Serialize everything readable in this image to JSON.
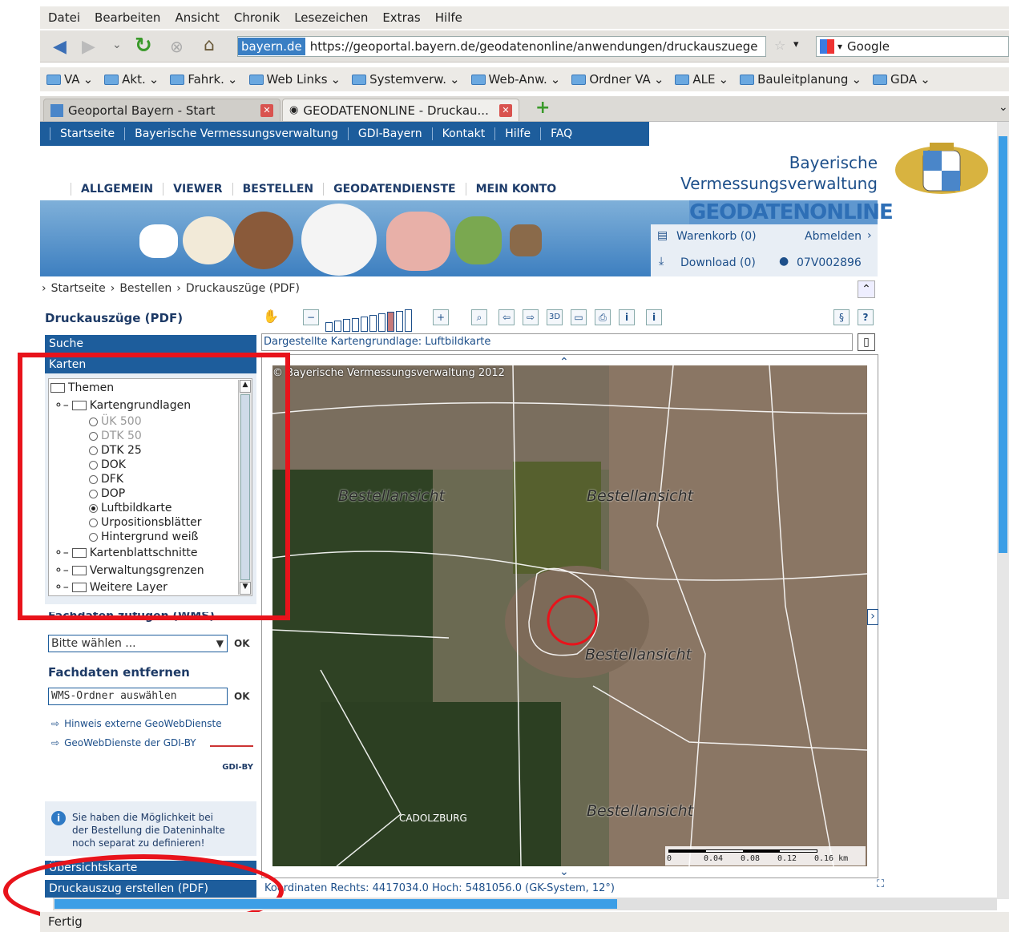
{
  "browser": {
    "menu": [
      "Datei",
      "Bearbeiten",
      "Ansicht",
      "Chronik",
      "Lesezeichen",
      "Extras",
      "Hilfe"
    ],
    "site_badge": "bayern.de",
    "url": "https://geoportal.bayern.de/geodatenonline/anwendungen/druckauszuege",
    "search_engine": "Google",
    "bookmarks": [
      "VA",
      "Akt.",
      "Fahrk.",
      "Web Links",
      "Systemverw.",
      "Web-Anw.",
      "Ordner VA",
      "ALE",
      "Bauleitplanung",
      "GDA"
    ],
    "tabs": [
      {
        "label": "Geoportal Bayern - Start"
      },
      {
        "label": "GEODATENONLINE - Druckau..."
      }
    ],
    "status": "Fertig"
  },
  "topnav": [
    "Startseite",
    "Bayerische Vermessungsverwaltung",
    "GDI-Bayern",
    "Kontakt",
    "Hilfe",
    "FAQ"
  ],
  "brand": {
    "line1": "Bayerische",
    "line2": "Vermessungsverwaltung",
    "banner": "GEODATENONLINE"
  },
  "mainnav": [
    "ALLGEMEIN",
    "VIEWER",
    "BESTELLEN",
    "GEODATENDIENSTE",
    "MEIN KONTO"
  ],
  "user": {
    "warenkorb": "Warenkorb (0)",
    "abmelden": "Abmelden",
    "download": "Download (0)",
    "userid": "07V002896"
  },
  "breadcrumb": [
    "Startseite",
    "Bestellen",
    "Druckauszüge (PDF)"
  ],
  "left": {
    "title": "Druckauszüge (PDF)",
    "suche": "Suche",
    "karten": "Karten",
    "tree": {
      "themen": "Themen",
      "kartengrundlagen": "Kartengrundlagen",
      "options": [
        {
          "label": "ÜK 500",
          "enabled": false,
          "selected": false
        },
        {
          "label": "DTK 50",
          "enabled": false,
          "selected": false
        },
        {
          "label": "DTK 25",
          "enabled": true,
          "selected": false
        },
        {
          "label": "DOK",
          "enabled": true,
          "selected": false
        },
        {
          "label": "DFK",
          "enabled": true,
          "selected": false
        },
        {
          "label": "DOP",
          "enabled": true,
          "selected": false
        },
        {
          "label": "Luftbildkarte",
          "enabled": true,
          "selected": true
        },
        {
          "label": "Urpositionsblätter",
          "enabled": true,
          "selected": false
        },
        {
          "label": "Hintergrund weiß",
          "enabled": true,
          "selected": false
        }
      ],
      "kartenblattschnitte": "Kartenblattschnitte",
      "verwaltungsgrenzen": "Verwaltungsgrenzen",
      "weitere": "Weitere Layer"
    },
    "fachdaten_zufuegen": "Fachdaten zufügen (WMS)",
    "bitte_waehlen": "Bitte wählen ...",
    "ok": "OK",
    "fachdaten_entfernen": "Fachdaten entfernen",
    "wms_ordner": "WMS-Ordner auswählen",
    "link1": "Hinweis externe GeoWebDienste",
    "link2": "GeoWebDienste der GDI-BY",
    "gdi_logo": "GDI-BY",
    "info": [
      "Sie haben die Möglichkeit bei",
      "der Bestellung die Dateninhalte",
      "noch separat zu definieren!"
    ],
    "uebersichtskarte": "Übersichtskarte",
    "druckauszug": "Druckauszug erstellen (PDF)"
  },
  "map": {
    "base_label": "Dargestellte Kartengrundlage: Luftbildkarte",
    "copyright": "© Bayerische Vermessungsverwaltung 2012",
    "watermark": "Bestellansicht",
    "place": "CADOLZBURG",
    "scale_ticks": [
      "0",
      "0.04",
      "0.08",
      "0.12",
      "0.16 km"
    ],
    "zoom_steps": 10,
    "zoom_level": 0.75,
    "coords": "Koordinaten Rechts: 4417034.0 Hoch: 5481056.0 (GK-System, 12°)"
  },
  "annotation_color": "#e8131b",
  "accent": "#1d5d9c"
}
